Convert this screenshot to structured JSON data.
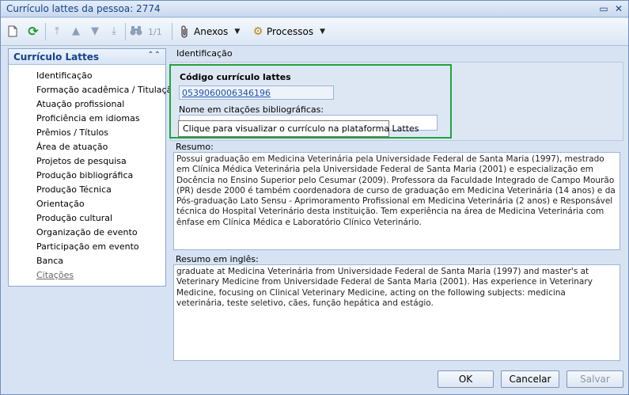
{
  "window": {
    "title": "Currículo lattes da pessoa: 2774",
    "minimize_glyph": "▭",
    "close_glyph": "✕"
  },
  "toolbar": {
    "record_position": "1/1",
    "anexos_label": "Anexos",
    "processos_label": "Processos"
  },
  "sidebar": {
    "title": "Currículo Lattes",
    "items": [
      {
        "label": "Identificação"
      },
      {
        "label": "Formação acadêmica / Titulação"
      },
      {
        "label": "Atuação profissional"
      },
      {
        "label": "Proficiência em idiomas"
      },
      {
        "label": "Prêmios / Títulos"
      },
      {
        "label": "Área de atuação"
      },
      {
        "label": "Projetos de pesquisa"
      },
      {
        "label": "Produção bibliográfica"
      },
      {
        "label": "Produção Técnica"
      },
      {
        "label": "Orientação"
      },
      {
        "label": "Produção cultural"
      },
      {
        "label": "Organização de evento"
      },
      {
        "label": "Participação em evento"
      },
      {
        "label": "Banca"
      },
      {
        "label": "Citações"
      }
    ]
  },
  "identificacao": {
    "section_title": "Identificação",
    "codigo_label": "Código currículo lattes",
    "codigo_value": "0539060006346196",
    "nome_citacoes_label": "Nome em citações bibliográficas:",
    "nome_citacoes_value": "",
    "tooltip": "Clique para visualizar o currículo na plataforma Lattes"
  },
  "resumo": {
    "label": "Resumo:",
    "text": "Possui graduação em Medicina Veterinária pela Universidade Federal de Santa Maria (1997), mestrado em Clínica Médica Veterinária pela Universidade Federal de Santa Maria (2001) e especialização em Docência no Ensino Superior pelo Cesumar (2009). Professora da Faculdade Integrado de Campo Mourão (PR) desde 2000 é também coordenadora de curso de graduação em Medicina Veterinária (14 anos) e da Pós-graduação Lato Sensu - Aprimoramento Profissional em Medicina Veterinária (2 anos) e Responsável técnica do Hospital Veterinário desta instituição. Tem experiência na área de Medicina Veterinária com ênfase em Clínica Médica e Laboratório Clínico Veterinário."
  },
  "resumo_ingles": {
    "label": "Resumo em inglês:",
    "text": "graduate at Medicina Veterinária from Universidade Federal de Santa Maria (1997) and master's at Veterinary Medicine from Universidade Federal de Santa Maria (2001). Has experience in Veterinary Medicine, focusing on Clinical Veterinary Medicine, acting on the following subjects: medicina veterinária, teste seletivo, cães, função hepática and estágio."
  },
  "footer": {
    "ok_label": "OK",
    "cancel_label": "Cancelar",
    "save_label": "Salvar"
  }
}
